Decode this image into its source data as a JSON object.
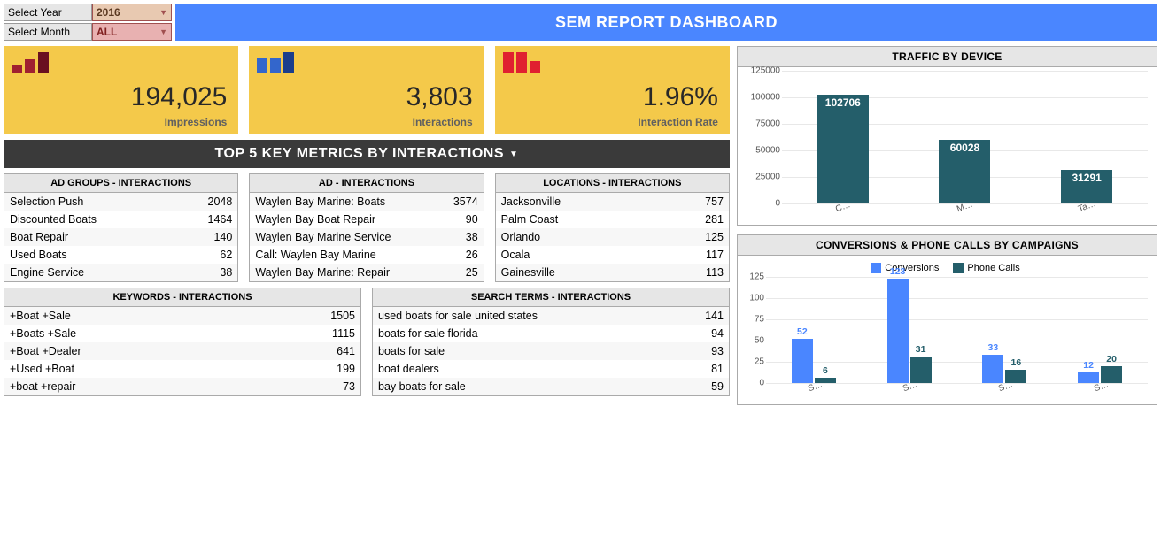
{
  "filters": {
    "year_label": "Select Year",
    "year_value": "2016",
    "month_label": "Select Month",
    "month_value": "ALL"
  },
  "title": "SEM REPORT DASHBOARD",
  "kpi": [
    {
      "value": "194,025",
      "label": "Impressions",
      "bars": [
        {
          "h": 10,
          "c": "#a02030"
        },
        {
          "h": 16,
          "c": "#a02030"
        },
        {
          "h": 24,
          "c": "#6a1020"
        }
      ]
    },
    {
      "value": "3,803",
      "label": "Interactions",
      "bars": [
        {
          "h": 18,
          "c": "#3366cc"
        },
        {
          "h": 18,
          "c": "#3366cc"
        },
        {
          "h": 24,
          "c": "#1a3e8c"
        }
      ]
    },
    {
      "value": "1.96%",
      "label": "Interaction Rate",
      "bars": [
        {
          "h": 24,
          "c": "#e02030"
        },
        {
          "h": 24,
          "c": "#e02030"
        },
        {
          "h": 14,
          "c": "#e02030"
        }
      ]
    }
  ],
  "section_header": "TOP 5 KEY METRICS BY INTERACTIONS",
  "tables_top": [
    {
      "title": "AD GROUPS - INTERACTIONS",
      "rows": [
        [
          "Selection Push",
          "2048"
        ],
        [
          "Discounted Boats",
          "1464"
        ],
        [
          "Boat Repair",
          "140"
        ],
        [
          "Used Boats",
          "62"
        ],
        [
          "Engine Service",
          "38"
        ]
      ]
    },
    {
      "title": "AD - INTERACTIONS",
      "rows": [
        [
          "Waylen Bay Marine: Boats",
          "3574"
        ],
        [
          "Waylen Bay Boat Repair",
          "90"
        ],
        [
          "Waylen Bay Marine Service",
          "38"
        ],
        [
          "Call: Waylen Bay Marine",
          "26"
        ],
        [
          "Waylen Bay Marine: Repair",
          "25"
        ]
      ]
    },
    {
      "title": "LOCATIONS - INTERACTIONS",
      "rows": [
        [
          "Jacksonville",
          "757"
        ],
        [
          "Palm Coast",
          "281"
        ],
        [
          "Orlando",
          "125"
        ],
        [
          "Ocala",
          "117"
        ],
        [
          "Gainesville",
          "113"
        ]
      ]
    }
  ],
  "tables_bottom": [
    {
      "title": "KEYWORDS - INTERACTIONS",
      "rows": [
        [
          "+Boat +Sale",
          "1505"
        ],
        [
          "+Boats +Sale",
          "1115"
        ],
        [
          "+Boat +Dealer",
          "641"
        ],
        [
          "+Used +Boat",
          "199"
        ],
        [
          "+boat +repair",
          "73"
        ]
      ]
    },
    {
      "title": "SEARCH TERMS - INTERACTIONS",
      "rows": [
        [
          "used boats for sale united states",
          "141"
        ],
        [
          "boats for sale florida",
          "94"
        ],
        [
          "boats for sale",
          "93"
        ],
        [
          "boat dealers",
          "81"
        ],
        [
          "bay boats for sale",
          "59"
        ]
      ]
    }
  ],
  "chart_data": [
    {
      "type": "bar",
      "title": "TRAFFIC BY DEVICE",
      "categories": [
        "C…",
        "M…",
        "Ta…"
      ],
      "values": [
        102706,
        60028,
        31291
      ],
      "ylim": [
        0,
        125000
      ],
      "yticks": [
        0,
        25000,
        50000,
        75000,
        100000,
        125000
      ],
      "color": "#245e6a"
    },
    {
      "type": "bar",
      "title": "CONVERSIONS & PHONE CALLS BY CAMPAIGNS",
      "categories": [
        "S…",
        "S…",
        "S…",
        "S…"
      ],
      "series": [
        {
          "name": "Conversions",
          "color": "#4a86ff",
          "values": [
            52,
            123,
            33,
            12
          ]
        },
        {
          "name": "Phone Calls",
          "color": "#245e6a",
          "values": [
            6,
            31,
            16,
            20
          ]
        }
      ],
      "ylim": [
        0,
        125
      ],
      "yticks": [
        0,
        25,
        50,
        75,
        100,
        125
      ]
    }
  ]
}
